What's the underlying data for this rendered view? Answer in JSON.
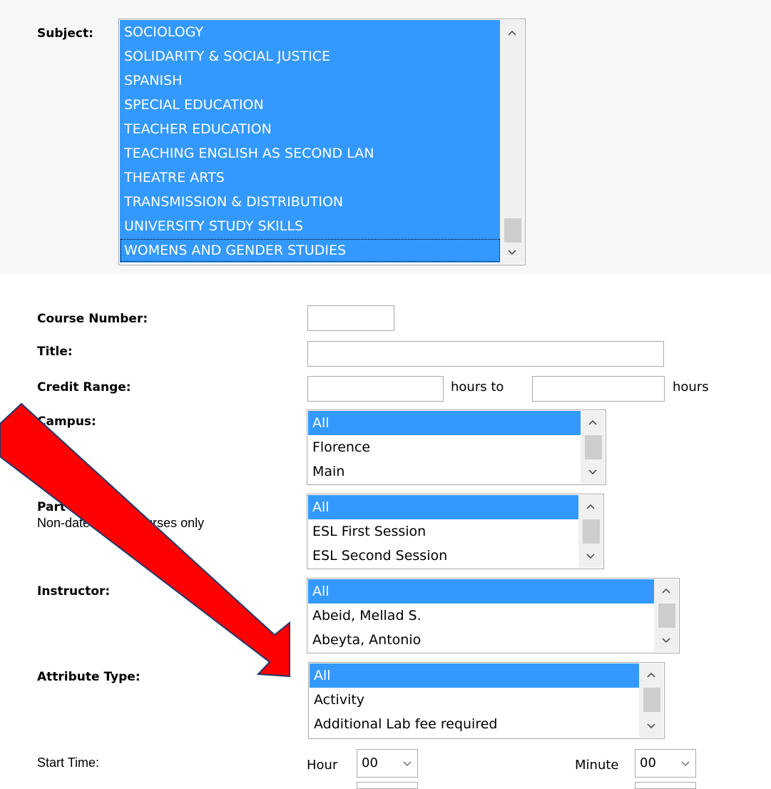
{
  "subject": {
    "label": "Subject:",
    "options": [
      "SOCIOLOGY",
      "SOLIDARITY & SOCIAL JUSTICE",
      "SPANISH",
      "SPECIAL EDUCATION",
      "TEACHER EDUCATION",
      "TEACHING ENGLISH AS SECOND LAN",
      "THEATRE ARTS",
      "TRANSMISSION & DISTRIBUTION",
      "UNIVERSITY STUDY SKILLS",
      "WOMENS AND GENDER STUDIES"
    ]
  },
  "course_number": {
    "label": "Course Number:",
    "value": ""
  },
  "title": {
    "label": "Title:",
    "value": ""
  },
  "credit_range": {
    "label": "Credit Range:",
    "from": "",
    "to": "",
    "unit_to": "hours to",
    "unit_end": "hours"
  },
  "campus": {
    "label": "Campus:",
    "options": [
      "All",
      "Florence",
      "Main"
    ]
  },
  "part_of_term": {
    "label": "Part of Term:",
    "note": "Non-date based courses only",
    "options": [
      "All",
      "ESL First Session",
      "ESL Second Session"
    ]
  },
  "instructor": {
    "label": "Instructor:",
    "options": [
      "All",
      "Abeid, Mellad S.",
      "Abeyta, Antonio"
    ]
  },
  "attribute_type": {
    "label": "Attribute Type:",
    "options": [
      "All",
      "Activity",
      "Additional Lab fee required"
    ]
  },
  "start_time": {
    "label": "Start Time:",
    "hour_label": "Hour",
    "hour_value": "00",
    "minute_label": "Minute",
    "minute_value": "00"
  },
  "colors": {
    "selection": "#3399ff",
    "annotation_arrow": "#ff0000"
  },
  "icons": {
    "scroll_up": "chevron-up-icon",
    "scroll_down": "chevron-down-icon",
    "dropdown": "chevron-down-icon"
  }
}
